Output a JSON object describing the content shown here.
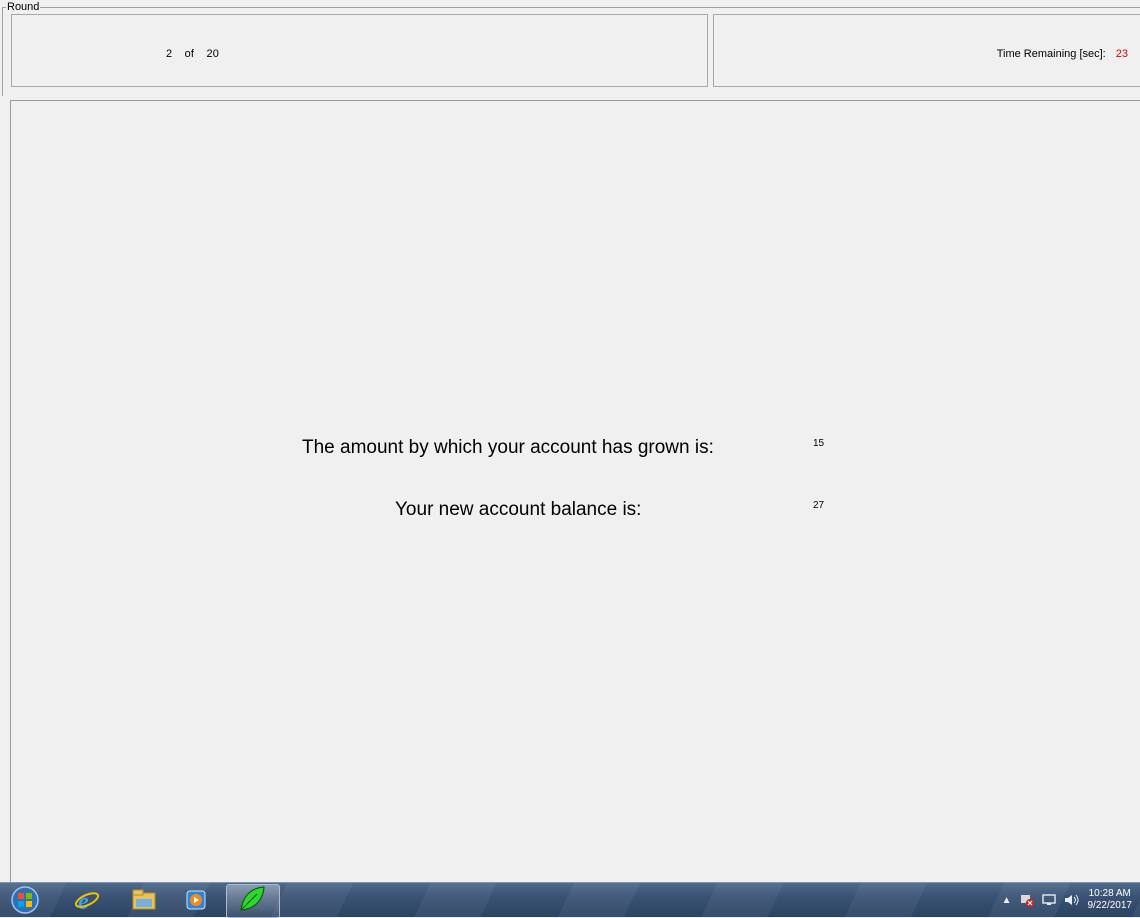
{
  "round": {
    "legend": "Round",
    "current": "2",
    "of_label": "of",
    "total": "20"
  },
  "timer": {
    "label": "Time Remaining [sec]:",
    "value": "23",
    "value_color": "#e00000"
  },
  "results": {
    "growth_label": "The amount by which your account has grown is:",
    "growth_value": "15",
    "balance_label": "Your new account balance is:",
    "balance_value": "27"
  },
  "taskbar": {
    "icons": [
      "windows-start-orb",
      "internet-explorer-icon",
      "file-explorer-icon",
      "media-player-icon",
      "leaf-app-icon"
    ],
    "tray_expand": "▲",
    "clock_time": "10:28 AM",
    "clock_date": "9/22/2017"
  }
}
